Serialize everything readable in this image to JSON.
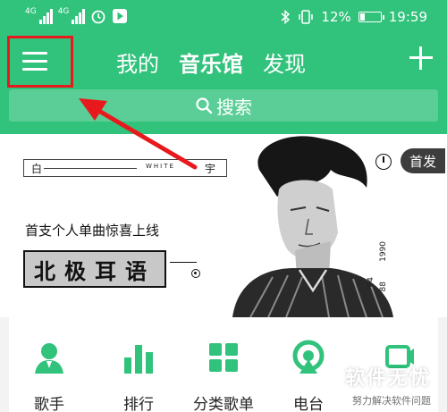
{
  "statusbar": {
    "signal1": "4G",
    "signal2": "4G",
    "battery": "12%",
    "time": "19:59"
  },
  "header": {
    "tabs": [
      {
        "label": "我的"
      },
      {
        "label": "音乐馆"
      },
      {
        "label": "发现"
      }
    ],
    "search_label": "搜索"
  },
  "banner": {
    "title_left": "白",
    "title_mid": "WHITE",
    "title_right": "宇",
    "subtitle": "首支个人单曲惊喜上线",
    "song": "北极耳语",
    "badge": "首发",
    "meta1": "1990",
    "meta2": "04",
    "meta3": "88"
  },
  "quicknav": {
    "items": [
      {
        "label": "歌手",
        "icon": "singer-icon"
      },
      {
        "label": "排行",
        "icon": "chart-icon"
      },
      {
        "label": "分类歌单",
        "icon": "grid-icon"
      },
      {
        "label": "电台",
        "icon": "radio-icon"
      }
    ]
  },
  "watermark": {
    "title": "软件无忧",
    "subtitle": "努力解决软件问题"
  },
  "colors": {
    "brand": "#31c27c",
    "highlight": "#e8191d"
  }
}
